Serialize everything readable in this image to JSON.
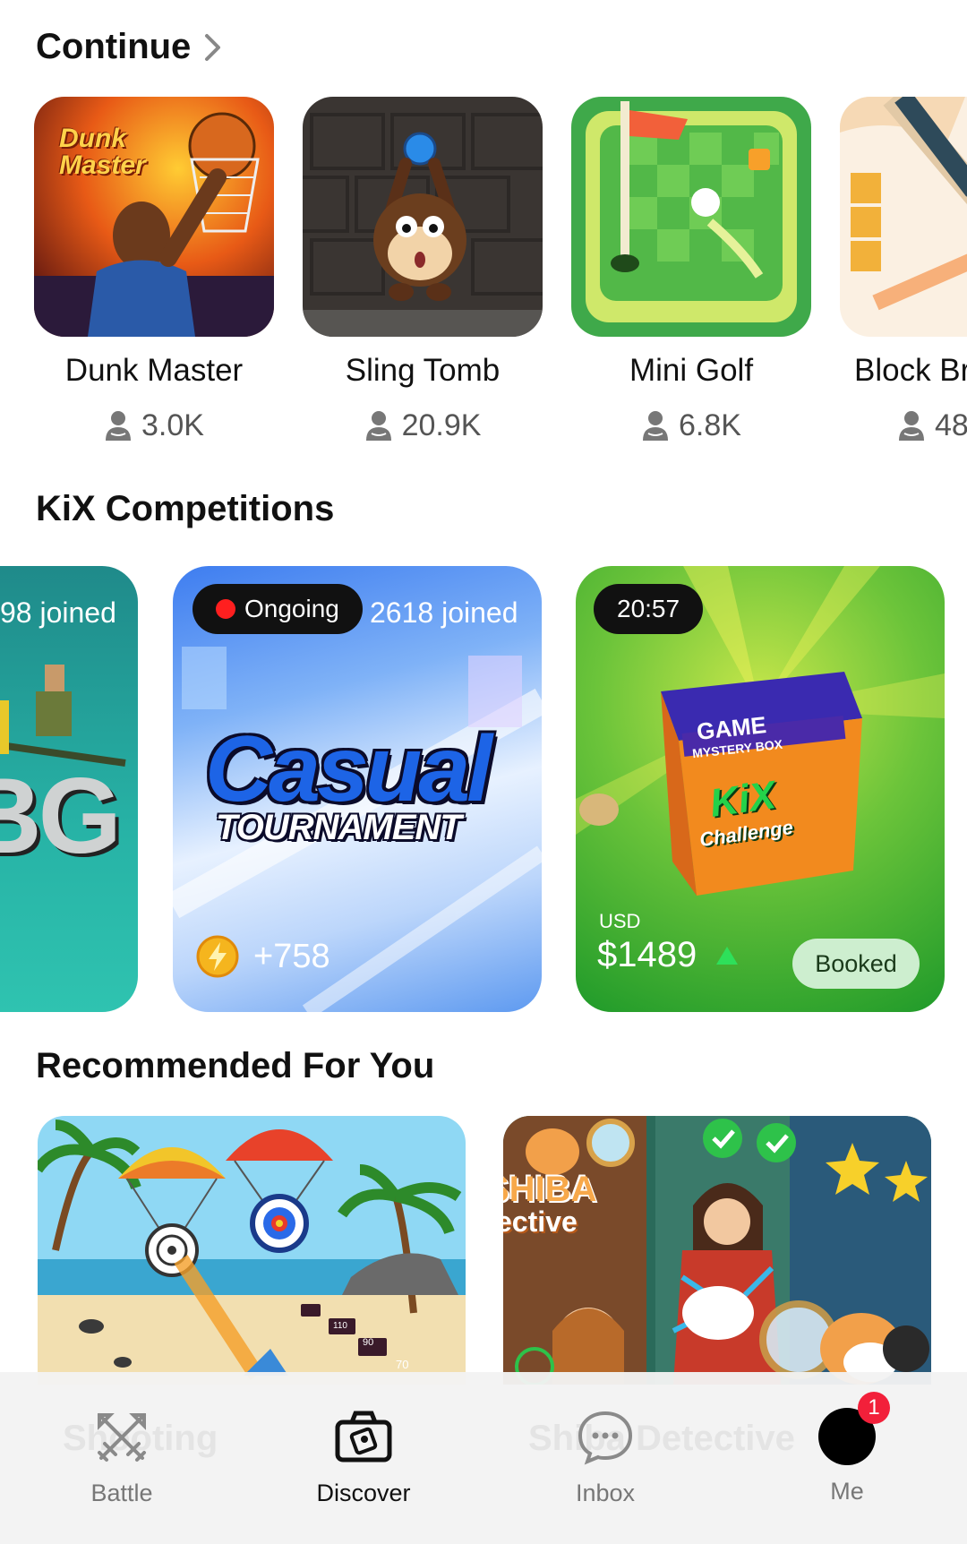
{
  "continue_section": {
    "title": "Continue",
    "games": [
      {
        "name": "Dunk Master",
        "players": "3.0K",
        "thumb_title": "Dunk Master"
      },
      {
        "name": "Sling Tomb",
        "players": "20.9K"
      },
      {
        "name": "Mini Golf",
        "players": "6.8K"
      },
      {
        "name": "Block Br",
        "players": "48"
      }
    ]
  },
  "competitions_section": {
    "title": "KiX Competitions",
    "cards": [
      {
        "joined": "98 joined",
        "art_text": "BG"
      },
      {
        "status": "Ongoing",
        "joined": "2618 joined",
        "art_title": "Casual",
        "art_subtitle": "TOURNAMENT",
        "reward": "+758"
      },
      {
        "timer": "20:57",
        "currency": "USD",
        "prize": "$1489",
        "button": "Booked",
        "box_line1": "GAME",
        "box_line2": "MYSTERY BOX",
        "box_brand": "KiX",
        "box_brand_sub": "Challenge"
      }
    ]
  },
  "recommended_section": {
    "title": "Recommended For You",
    "cards": [
      {
        "name_partial": "Shooting",
        "targets": [
          "110",
          "90",
          "70"
        ]
      },
      {
        "name_partial": "Shiba Detective",
        "art_text_1": "SHIBA",
        "art_text_2": "ective"
      }
    ]
  },
  "bottom_nav": {
    "items": [
      {
        "label": "Battle",
        "icon": "battle-icon"
      },
      {
        "label": "Discover",
        "icon": "discover-icon"
      },
      {
        "label": "Inbox",
        "icon": "inbox-icon"
      },
      {
        "label": "Me",
        "icon": "avatar",
        "badge": "1"
      }
    ]
  },
  "colors": {
    "accent_green": "#1fa83a",
    "badge_red": "#f2203a",
    "live_red": "#ff1f1f"
  }
}
